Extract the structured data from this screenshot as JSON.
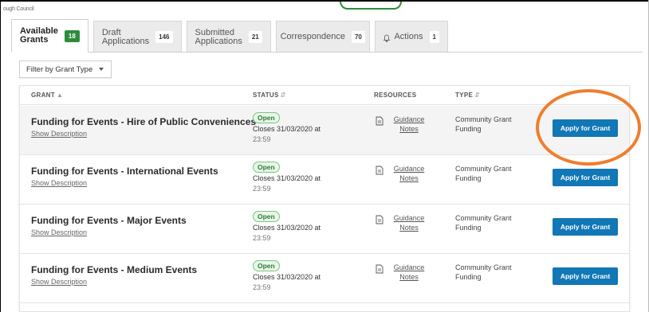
{
  "brand": {
    "snippet": "ough Council"
  },
  "tabs": [
    {
      "line1": "Available",
      "line2": "Grants",
      "count": "18",
      "active": true
    },
    {
      "line1": "Draft",
      "line2": "Applications",
      "count": "146"
    },
    {
      "line1": "Submitted",
      "line2": "Applications",
      "count": "21"
    },
    {
      "label": "Correspondence",
      "count": "70"
    },
    {
      "label": "Actions",
      "count": "1",
      "icon": "bell-icon"
    }
  ],
  "filter": {
    "label": "Filter by Grant Type"
  },
  "table": {
    "headers": {
      "grant": "GRANT",
      "status": "STATUS",
      "resources": "RESOURCES",
      "type": "TYPE"
    },
    "rows": [
      {
        "title": "Funding for Events - Hire of Public Conveniences",
        "show": "Show Description",
        "status": "Open",
        "closes": "Closes 31/03/2020 at",
        "time": "23:59",
        "res1": "Guidance",
        "res2": "Notes",
        "type1": "Community Grant",
        "type2": "Funding",
        "action": "Apply for Grant"
      },
      {
        "title": "Funding for Events - International Events",
        "show": "Show Description",
        "status": "Open",
        "closes": "Closes 31/03/2020 at",
        "time": "23:59",
        "res1": "Guidance",
        "res2": "Notes",
        "type1": "Community Grant",
        "type2": "Funding",
        "action": "Apply for Grant"
      },
      {
        "title": "Funding for Events - Major Events",
        "show": "Show Description",
        "status": "Open",
        "closes": "Closes 31/03/2020 at",
        "time": "23:59",
        "res1": "Guidance",
        "res2": "Notes",
        "type1": "Community Grant",
        "type2": "Funding",
        "action": "Apply for Grant"
      },
      {
        "title": "Funding for Events - Medium Events",
        "show": "Show Description",
        "status": "Open",
        "closes": "Closes 31/03/2020 at",
        "time": "23:59",
        "res1": "Guidance",
        "res2": "Notes",
        "type1": "Community Grant",
        "type2": "Funding",
        "action": "Apply for Grant"
      }
    ]
  },
  "colors": {
    "accent_green": "#2e8b3d",
    "primary_blue": "#1177b6",
    "annotation_orange": "#ef7d2f"
  }
}
